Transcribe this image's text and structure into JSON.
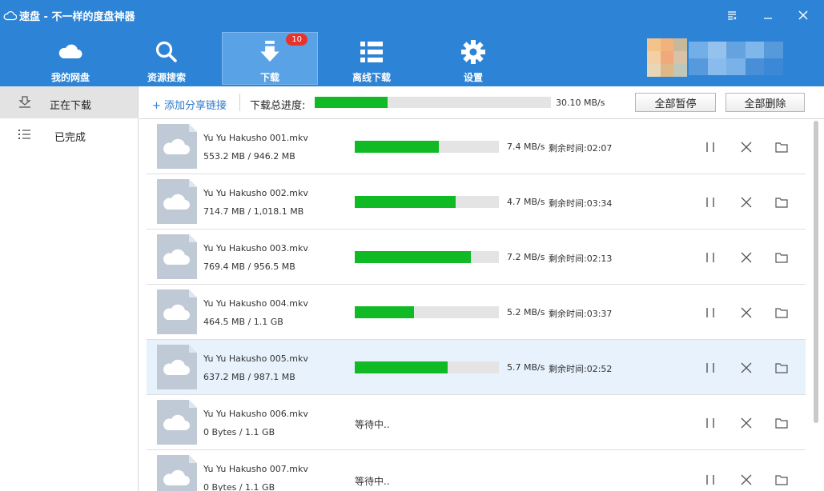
{
  "app": {
    "title": "速盘 - 不一样的度盘神器"
  },
  "nav": [
    {
      "label": "我的网盘",
      "icon": "cloud-icon"
    },
    {
      "label": "资源搜索",
      "icon": "search-icon"
    },
    {
      "label": "下载",
      "icon": "download-icon",
      "badge": "10",
      "active": true
    },
    {
      "label": "离线下载",
      "icon": "list-grid-icon"
    },
    {
      "label": "设置",
      "icon": "gear-icon"
    }
  ],
  "sidebar": {
    "items": [
      {
        "label": "正在下载",
        "icon": "download-tray-icon",
        "active": true
      },
      {
        "label": "已完成",
        "icon": "list-icon"
      }
    ]
  },
  "toolbar": {
    "add_link": "+ 添加分享链接",
    "total_label": "下载总进度:",
    "total_progress": 0.31,
    "total_speed": "30.10 MB/s",
    "pause_all": "全部暂停",
    "delete_all": "全部删除"
  },
  "downloads": [
    {
      "name": "Yu Yu Hakusho 001.mkv",
      "size": "553.2 MB / 946.2 MB",
      "progress": 0.584,
      "speed": "7.4 MB/s",
      "remaining": "剩余时间:02:07",
      "status": "downloading"
    },
    {
      "name": "Yu Yu Hakusho 002.mkv",
      "size": "714.7 MB / 1,018.1 MB",
      "progress": 0.702,
      "speed": "4.7 MB/s",
      "remaining": "剩余时间:03:34",
      "status": "downloading"
    },
    {
      "name": "Yu Yu Hakusho 003.mkv",
      "size": "769.4 MB / 956.5 MB",
      "progress": 0.804,
      "speed": "7.2 MB/s",
      "remaining": "剩余时间:02:13",
      "status": "downloading"
    },
    {
      "name": "Yu Yu Hakusho 004.mkv",
      "size": "464.5 MB / 1.1 GB",
      "progress": 0.412,
      "speed": "5.2 MB/s",
      "remaining": "剩余时间:03:37",
      "status": "downloading"
    },
    {
      "name": "Yu Yu Hakusho 005.mkv",
      "size": "637.2 MB / 987.1 MB",
      "progress": 0.645,
      "speed": "5.7 MB/s",
      "remaining": "剩余时间:02:52",
      "status": "downloading",
      "selected": true
    },
    {
      "name": "Yu Yu Hakusho 006.mkv",
      "size": "0 Bytes / 1.1 GB",
      "status": "waiting",
      "waiting_text": "等待中.."
    },
    {
      "name": "Yu Yu Hakusho 007.mkv",
      "size": "0 Bytes / 1.1 GB",
      "status": "waiting",
      "waiting_text": "等待中.."
    }
  ],
  "colors": {
    "header_bg": "#2d84d6",
    "nav_active_bg": "#5aa2e6",
    "progress_fill": "#0fba25",
    "progress_track": "#e4e4e4",
    "badge_bg": "#e8332b",
    "selected_row_bg": "#e7f2fd",
    "link": "#2d78c8"
  }
}
